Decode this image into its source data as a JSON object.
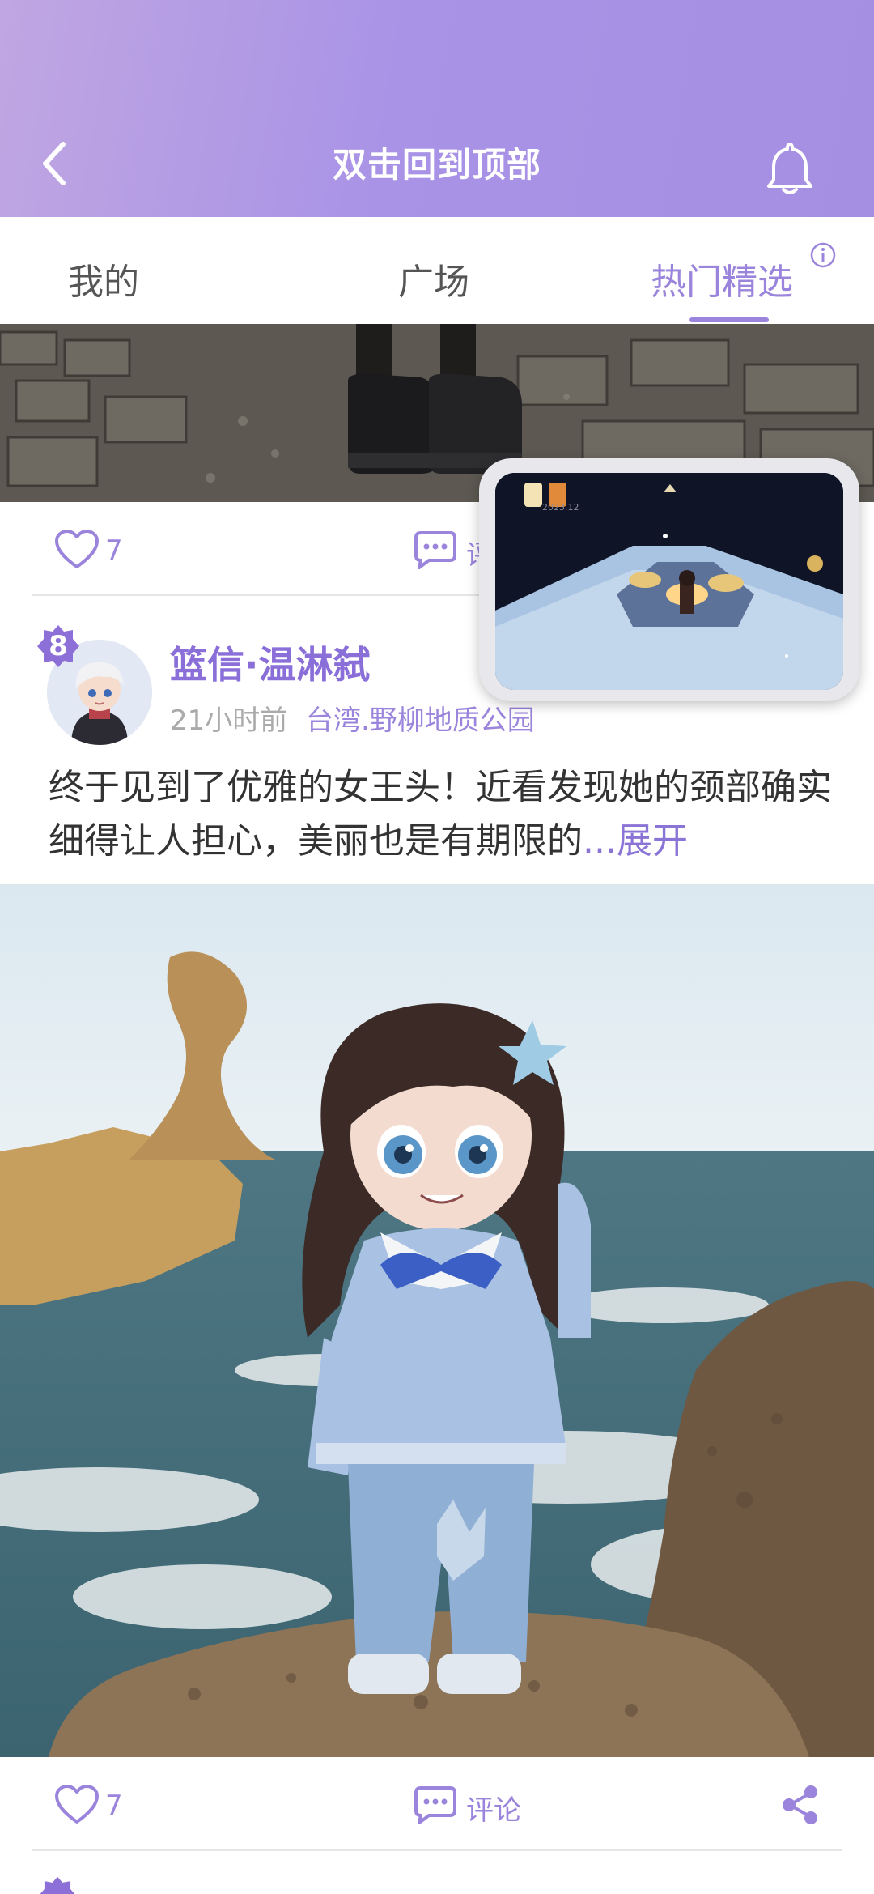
{
  "header": {
    "title": "双击回到顶部"
  },
  "tabs": [
    {
      "label": "我的"
    },
    {
      "label": "广场"
    },
    {
      "label": "热门精选"
    }
  ],
  "post_prev": {
    "likes": "7",
    "comment_label": "评"
  },
  "post": {
    "level": "8",
    "username": "篮信·温淋弑",
    "time": "21小时前",
    "location": "台湾.野柳地质公园",
    "text": "终于见到了优雅的女王头！近看发现她的颈部确实细得让人担心，美丽也是有期限的",
    "expand": "...展开",
    "likes": "7",
    "comment_label": "评论"
  },
  "pip": {
    "timestamp": "2023.12"
  },
  "colors": {
    "accent": "#9a84dc",
    "header_start": "#c0a6e2",
    "header_end": "#a48fe2"
  }
}
